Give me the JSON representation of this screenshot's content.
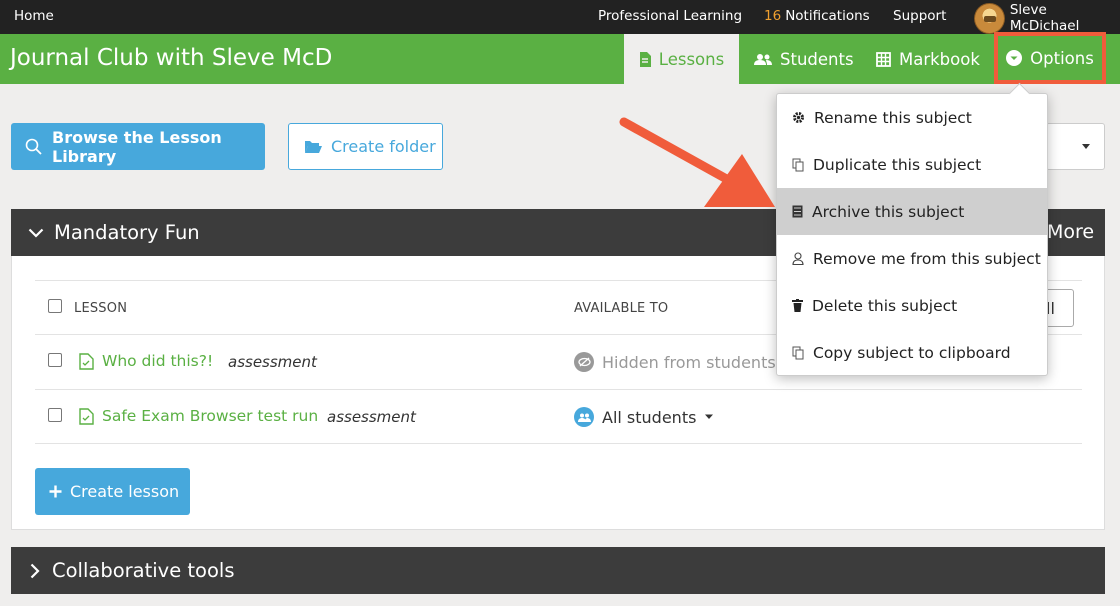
{
  "topbar": {
    "home": "Home",
    "professional_learning": "Professional Learning",
    "notif_count": "16",
    "notif_label": "Notifications",
    "support": "Support",
    "user_name": "Sleve McDichael"
  },
  "header": {
    "title": "Journal Club with Sleve McD",
    "tabs": {
      "lessons": "Lessons",
      "students": "Students",
      "markbook": "Markbook",
      "options": "Options"
    }
  },
  "actions": {
    "browse": "Browse the Lesson Library",
    "create_folder": "Create folder"
  },
  "section": {
    "title": "Mandatory Fun",
    "more": "More",
    "col_lesson": "LESSON",
    "col_available": "AVAILABLE TO",
    "partial_btn": "ll",
    "lessons": [
      {
        "name": "Who did this?!",
        "type": "assessment",
        "available": "Hidden from students"
      },
      {
        "name": "Safe Exam Browser test run",
        "type": "assessment",
        "available": "All students"
      }
    ],
    "create_lesson": "Create lesson"
  },
  "section2": {
    "title": "Collaborative tools"
  },
  "menu": {
    "items": [
      {
        "label": "Rename this subject",
        "icon": "gear-icon"
      },
      {
        "label": "Duplicate this subject",
        "icon": "copy-icon"
      },
      {
        "label": "Archive this subject",
        "icon": "archive-icon"
      },
      {
        "label": "Remove me from this subject",
        "icon": "person-icon"
      },
      {
        "label": "Delete this subject",
        "icon": "trash-icon"
      },
      {
        "label": "Copy subject to clipboard",
        "icon": "clipboard-icon"
      }
    ]
  },
  "colors": {
    "green": "#5ab043",
    "blue": "#47a8dc",
    "dark": "#3c3c3c",
    "highlight": "#f05c3b"
  }
}
